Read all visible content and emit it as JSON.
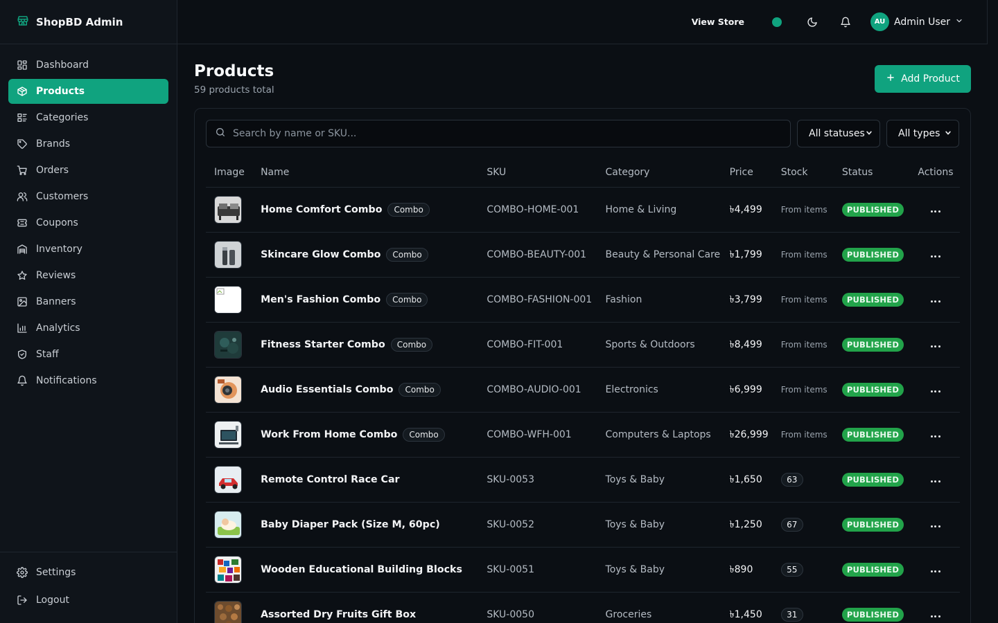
{
  "brand": {
    "name": "ShopBD Admin"
  },
  "sidebar": {
    "items": [
      {
        "label": "Dashboard",
        "icon": "dashboard-icon"
      },
      {
        "label": "Products",
        "icon": "package-icon",
        "active": true
      },
      {
        "label": "Categories",
        "icon": "categories-icon"
      },
      {
        "label": "Brands",
        "icon": "tag-icon"
      },
      {
        "label": "Orders",
        "icon": "cart-icon"
      },
      {
        "label": "Customers",
        "icon": "users-icon"
      },
      {
        "label": "Coupons",
        "icon": "ticket-icon"
      },
      {
        "label": "Inventory",
        "icon": "warehouse-icon"
      },
      {
        "label": "Reviews",
        "icon": "star-icon"
      },
      {
        "label": "Banners",
        "icon": "image-icon"
      },
      {
        "label": "Analytics",
        "icon": "chart-icon"
      },
      {
        "label": "Staff",
        "icon": "shield-icon"
      },
      {
        "label": "Notifications",
        "icon": "bell-icon"
      }
    ],
    "bottom": [
      {
        "label": "Settings",
        "icon": "gear-icon"
      },
      {
        "label": "Logout",
        "icon": "logout-icon"
      }
    ]
  },
  "header": {
    "view_store": "View Store",
    "user": {
      "initials": "AU",
      "name": "Admin User"
    }
  },
  "page": {
    "title": "Products",
    "subtitle": "59 products total",
    "add_button": "Add Product"
  },
  "filters": {
    "search_placeholder": "Search by name or SKU...",
    "status_selected": "All statuses",
    "type_selected": "All types"
  },
  "table": {
    "columns": [
      "Image",
      "Name",
      "SKU",
      "Category",
      "Price",
      "Stock",
      "Status",
      "Actions"
    ],
    "rows": [
      {
        "name": "Home Comfort Combo",
        "badge": "Combo",
        "sku": "COMBO-HOME-001",
        "category": "Home & Living",
        "price": "৳4,499",
        "stock": "From items",
        "stock_is_count": false,
        "status": "PUBLISHED"
      },
      {
        "name": "Skincare Glow Combo",
        "badge": "Combo",
        "sku": "COMBO-BEAUTY-001",
        "category": "Beauty & Personal Care",
        "price": "৳1,799",
        "stock": "From items",
        "stock_is_count": false,
        "status": "PUBLISHED"
      },
      {
        "name": "Men's Fashion Combo",
        "badge": "Combo",
        "sku": "COMBO-FASHION-001",
        "category": "Fashion",
        "price": "৳3,799",
        "stock": "From items",
        "stock_is_count": false,
        "status": "PUBLISHED"
      },
      {
        "name": "Fitness Starter Combo",
        "badge": "Combo",
        "sku": "COMBO-FIT-001",
        "category": "Sports & Outdoors",
        "price": "৳8,499",
        "stock": "From items",
        "stock_is_count": false,
        "status": "PUBLISHED"
      },
      {
        "name": "Audio Essentials Combo",
        "badge": "Combo",
        "sku": "COMBO-AUDIO-001",
        "category": "Electronics",
        "price": "৳6,999",
        "stock": "From items",
        "stock_is_count": false,
        "status": "PUBLISHED"
      },
      {
        "name": "Work From Home Combo",
        "badge": "Combo",
        "sku": "COMBO-WFH-001",
        "category": "Computers & Laptops",
        "price": "৳26,999",
        "stock": "From items",
        "stock_is_count": false,
        "status": "PUBLISHED"
      },
      {
        "name": "Remote Control Race Car",
        "badge": "",
        "sku": "SKU-0053",
        "category": "Toys & Baby",
        "price": "৳1,650",
        "stock": "63",
        "stock_is_count": true,
        "status": "PUBLISHED"
      },
      {
        "name": "Baby Diaper Pack (Size M, 60pc)",
        "badge": "",
        "sku": "SKU-0052",
        "category": "Toys & Baby",
        "price": "৳1,250",
        "stock": "67",
        "stock_is_count": true,
        "status": "PUBLISHED"
      },
      {
        "name": "Wooden Educational Building Blocks",
        "badge": "",
        "sku": "SKU-0051",
        "category": "Toys & Baby",
        "price": "৳890",
        "stock": "55",
        "stock_is_count": true,
        "status": "PUBLISHED"
      },
      {
        "name": "Assorted Dry Fruits Gift Box",
        "badge": "",
        "sku": "SKU-0050",
        "category": "Groceries",
        "price": "৳1,450",
        "stock": "31",
        "stock_is_count": true,
        "status": "PUBLISHED"
      }
    ]
  },
  "colors": {
    "accent": "#10a37f",
    "published": "#22a34a",
    "background": "#0b0f14"
  }
}
